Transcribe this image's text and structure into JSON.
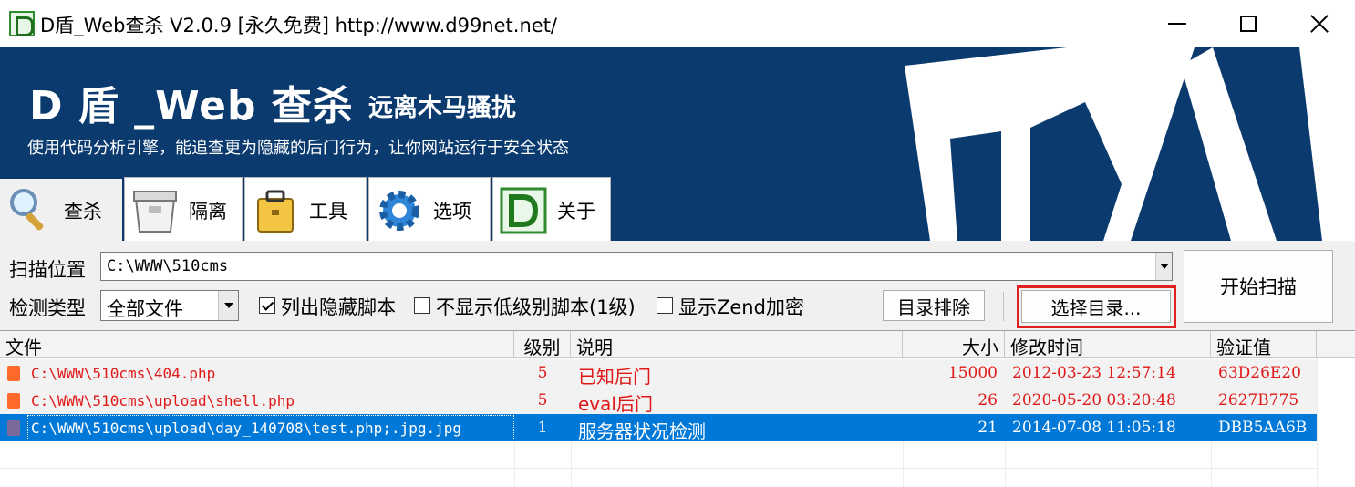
{
  "window": {
    "title": "D盾_Web查杀 V2.0.9 [永久免费] http://www.d99net.net/"
  },
  "banner": {
    "brand": "D 盾 _Web 查杀",
    "subtitle": "远离木马骚扰",
    "slogan": "使用代码分析引擎，能追查更为隐藏的后门行为，让你网站运行于安全状态",
    "colors": {
      "background": "#0a3a6e"
    }
  },
  "tabs": [
    {
      "label": "查杀",
      "icon": "magnifier-icon",
      "active": true
    },
    {
      "label": "隔离",
      "icon": "quarantine-box-icon",
      "active": false
    },
    {
      "label": "工具",
      "icon": "toolbox-icon",
      "active": false
    },
    {
      "label": "选项",
      "icon": "gear-icon",
      "active": false
    },
    {
      "label": "关于",
      "icon": "d-shield-logo-icon",
      "active": false
    }
  ],
  "scan": {
    "location_label": "扫描位置",
    "location_value": "C:\\WWW\\510cms",
    "type_label": "检测类型",
    "type_value": "全部文件",
    "options": [
      {
        "label": "列出隐藏脚本",
        "checked": true
      },
      {
        "label": "不显示低级别脚本(1级)",
        "checked": false
      },
      {
        "label": "显示Zend加密",
        "checked": false
      }
    ],
    "exclude_dir_button": "目录排除",
    "choose_dir_button": "选择目录...",
    "start_button": "开始扫描"
  },
  "results": {
    "columns": [
      "文件",
      "级别",
      "说明",
      "大小",
      "修改时间",
      "验证值"
    ],
    "rows": [
      {
        "file": "C:\\WWW\\510cms\\404.php",
        "level": "5",
        "desc": "已知后门",
        "size": "15000",
        "mtime": "2012-03-23 12:57:14",
        "hash": "63D26E20",
        "status": "danger",
        "selected": false
      },
      {
        "file": "C:\\WWW\\510cms\\upload\\shell.php",
        "level": "5",
        "desc": "eval后门",
        "size": "26",
        "mtime": "2020-05-20 03:20:48",
        "hash": "2627B775",
        "status": "danger",
        "selected": false
      },
      {
        "file": "C:\\WWW\\510cms\\upload\\day_140708\\test.php;.jpg.jpg",
        "level": "1",
        "desc": "服务器状况检测",
        "size": "21",
        "mtime": "2014-07-08 11:05:18",
        "hash": "DBB5AA6B",
        "status": "low",
        "selected": true
      }
    ],
    "colors": {
      "danger_text": "#e01818",
      "danger_icon": "#ff6a2b",
      "low_icon": "#7a6a9a",
      "selected_bg": "#0078d7",
      "row_danger_bg": "#f2f2f2"
    }
  }
}
